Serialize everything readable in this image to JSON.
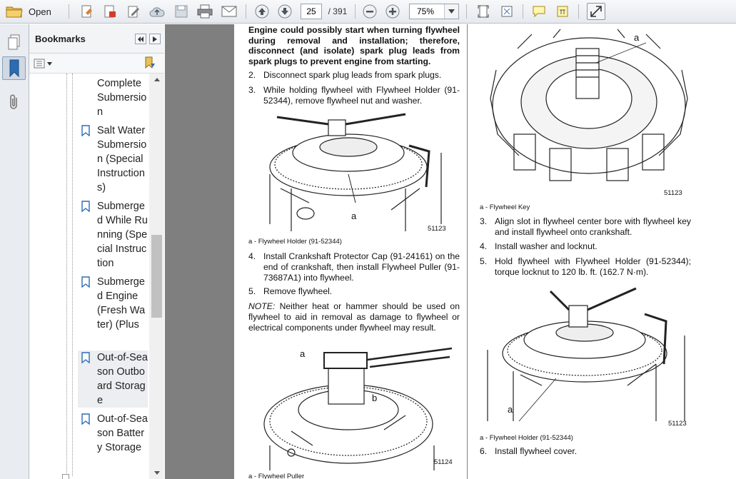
{
  "toolbar": {
    "open_label": "Open",
    "page_current": "25",
    "page_total": "/ 391",
    "zoom_value": "75%"
  },
  "bookmarks": {
    "title": "Bookmarks",
    "items": [
      {
        "label": "Complete Submersion"
      },
      {
        "label": "Salt Water Submersion (Special Instructions)"
      },
      {
        "label": "Submerged While Running (Special Instruction"
      },
      {
        "label": "Submerged Engine (Fresh Water) (Plus"
      },
      {
        "label": "Out-of-Season Outboard Storage"
      },
      {
        "label": "Out-of-Season Battery Storage"
      }
    ]
  },
  "page_left": {
    "warning": "Engine could possibly start when turning flywheel during removal and installation; therefore, disconnect (and isolate) spark plug leads from spark plugs to prevent engine from starting.",
    "step2_num": "2.",
    "step2": "Disconnect spark plug leads from spark plugs.",
    "step3_num": "3.",
    "step3": "While holding flywheel with Flywheel Holder (91-52344), remove flywheel nut and washer.",
    "fig1_callout": "a",
    "fig1_num": "51123",
    "fig1_caption": "a - Flywheel Holder (91-52344)",
    "step4_num": "4.",
    "step4": "Install Crankshaft Protector Cap (91-24161) on the end of crankshaft, then install Flywheel Puller (91-73687A1) into flywheel.",
    "step5_num": "5.",
    "step5": "Remove flywheel.",
    "note_label": "NOTE:",
    "note": " Neither heat or hammer should be used on flywheel to aid in removal as damage to flywheel or electrical components under flywheel may result.",
    "fig2_callout_a": "a",
    "fig2_callout_b": "b",
    "fig2_num": "51124",
    "fig2_caption": "a - Flywheel Puller"
  },
  "page_right": {
    "fig1_callout": "a",
    "fig1_num": "51123",
    "fig1_caption": "a - Flywheel Key",
    "step3_num": "3.",
    "step3": "Align slot in flywheel center bore with flywheel key and install flywheel onto crankshaft.",
    "step4_num": "4.",
    "step4": "Install washer and locknut.",
    "step5_num": "5.",
    "step5": "Hold flywheel with Flywheel Holder (91-52344); torque locknut to 120 lb. ft. (162.7 N·m).",
    "fig2_callout": "a",
    "fig2_num": "51123",
    "fig2_caption": "a - Flywheel Holder (91-52344)",
    "step6_num": "6.",
    "step6": "Install flywheel cover."
  }
}
